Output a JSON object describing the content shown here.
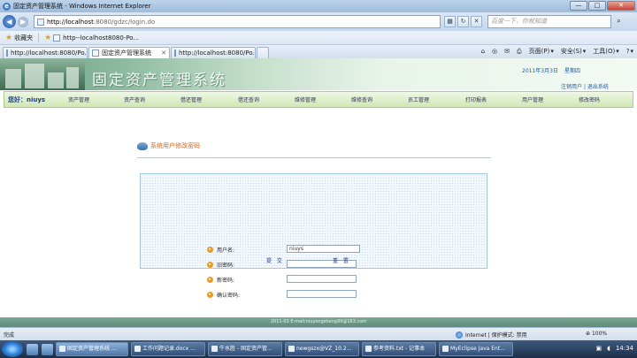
{
  "window": {
    "title": "固定资产管理系统 - Windows Internet Explorer",
    "minimize": "—",
    "maximize": "□",
    "close": "✕"
  },
  "address": {
    "url_host": "http://localhost",
    "url_path": ":8080/gdzc/login.do",
    "search_placeholder": "百度一下，你就知道"
  },
  "favorites": {
    "label": "收藏夹",
    "link": "http--localhost8080-Po..."
  },
  "tabs": [
    {
      "label": "http://localhost:8080/Po..."
    },
    {
      "label": "固定资产管理系统"
    },
    {
      "label": "http://localhost:8080/Po..."
    }
  ],
  "commands": {
    "page": "页面(P)",
    "safety": "安全(S)",
    "tools": "工具(O)",
    "help": "?"
  },
  "banner": {
    "title": "固定资产管理系统",
    "date": "2011年3月3日",
    "weekday": "星期四",
    "logout_user": "注销用户",
    "exit_system": "退出系统",
    "separator": "|"
  },
  "menu": {
    "hello": "您好：niuys",
    "items": [
      "资产管理",
      "资产查询",
      "借还管理",
      "借还查询",
      "维修管理",
      "维修查询",
      "员工管理",
      "打印报表",
      "用户管理",
      "修改密码"
    ]
  },
  "password_form": {
    "heading": "系统用户修改密码",
    "username_label": "用户名:",
    "username_value": "niuys",
    "old_password_label": "旧密码:",
    "new_password_label": "新密码:",
    "confirm_password_label": "确认密码:",
    "submit": "提 交",
    "reset": "重 置"
  },
  "footer": {
    "text": "2011-03 E-mail:niuyongsheng99@163.com"
  },
  "status": {
    "left": "完成",
    "zone": "Internet | 保护模式: 禁用",
    "zoom": "100%"
  },
  "taskbar": {
    "tasks": [
      "固定资产管理系统 ...",
      "工作问题记录.docx ...",
      "牛水胜 - 固定资产管...",
      "newgszx@VZ_10.2...",
      "参考资料.txt - 记事本",
      "MyEclipse Java Ent..."
    ],
    "clock": "14:34"
  }
}
